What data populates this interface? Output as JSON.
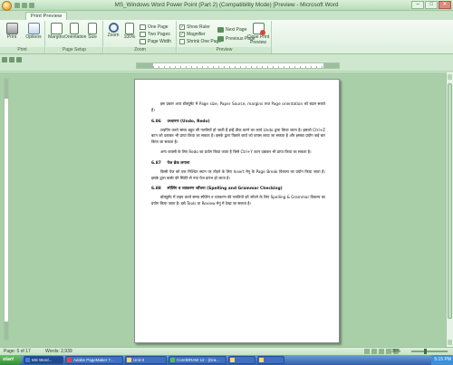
{
  "window": {
    "title": "MS_Windows Word Power Point (Part 2) (Compatibility Mode) [Preview - Microsoft Word",
    "controls": [
      "–",
      "□",
      "✕"
    ]
  },
  "ribbon": {
    "tab": "Print Preview",
    "groups": {
      "print": {
        "label": "Print",
        "buttons": [
          "Print",
          "Options"
        ]
      },
      "page_setup": {
        "label": "Page Setup",
        "buttons": [
          "Margins",
          "Orientation",
          "Size"
        ]
      },
      "zoom": {
        "label": "Zoom",
        "buttons": [
          "Zoom",
          "100%"
        ],
        "small": [
          "One Page",
          "Two Pages",
          "Page Width"
        ]
      },
      "preview": {
        "label": "Preview",
        "checks": [
          "Show Ruler",
          "Magnifier",
          "Shrink One Page"
        ],
        "small": [
          "Next Page",
          "Previous Page"
        ],
        "close": "Close Print Preview"
      }
    }
  },
  "document": {
    "paragraphs": [
      {
        "type": "para",
        "text": "इस प्रकार आप डॉक्यूमेंट में Page size, Paper Source, margins तथा Page orientation को बदल सकते हैं।"
      },
      {
        "type": "heading",
        "num": "6.86",
        "text": "उच्चारण (Undo, Redo)"
      },
      {
        "type": "para",
        "text": "टाइपिंग करते समय बहुत सी गलतियाँ हो जाती हैं इन्हें ठीक करने का कार्य Undo द्वारा किया जाता है। इसको Ctrl+Z बटन को दबाकर भी प्राप्त किया जा सकता है। इसके द्वारा पिछले कार्य को वापस लाया जा सकता है और इसका प्रयोग कई बार किया जा सकता है।"
      },
      {
        "type": "para",
        "text": "अन्य वापसी के लिए Redo का प्रयोग किया जाता है जिसे Ctrl+Y बटन दबाकर भी प्राप्त किया जा सकता है।"
      },
      {
        "type": "heading",
        "num": "6.87",
        "text": "पेज ब्रेक लगाना"
      },
      {
        "type": "para",
        "text": "किसी पेज को एक निश्चित स्थान पर तोड़ने के लिए Insert मेनू के Page Break विकल्प का प्रयोग किया जाता है। इसके द्वारा कर्सर की स्थिति से नया पेज प्रारंभ हो जाता है।"
      },
      {
        "type": "heading",
        "num": "6.88",
        "text": "स्पेलिंग व व्याकरण जाँचना (Spelling and Grammar Checking)"
      },
      {
        "type": "para",
        "text": "डॉक्यूमेंट में टाइप करते समय स्पेलिंग व व्याकरण की गलतियों को जाँचने के लिए Spelling & Grammar विकल्प का प्रयोग किया जाता है। इसे Tools या Review मेनू में देखा जा सकता है।"
      }
    ]
  },
  "statusbar": {
    "page": "Page: 5 of 17",
    "words": "Words: 2,939",
    "zoom": "35%"
  },
  "taskbar": {
    "start": "start",
    "items": [
      "MS Word...",
      "Adobe PageMaker 7...",
      "Unit-3",
      "CorelDRAW 12 - [Gra...",
      "",
      ""
    ],
    "clock": "5:15 PM"
  }
}
